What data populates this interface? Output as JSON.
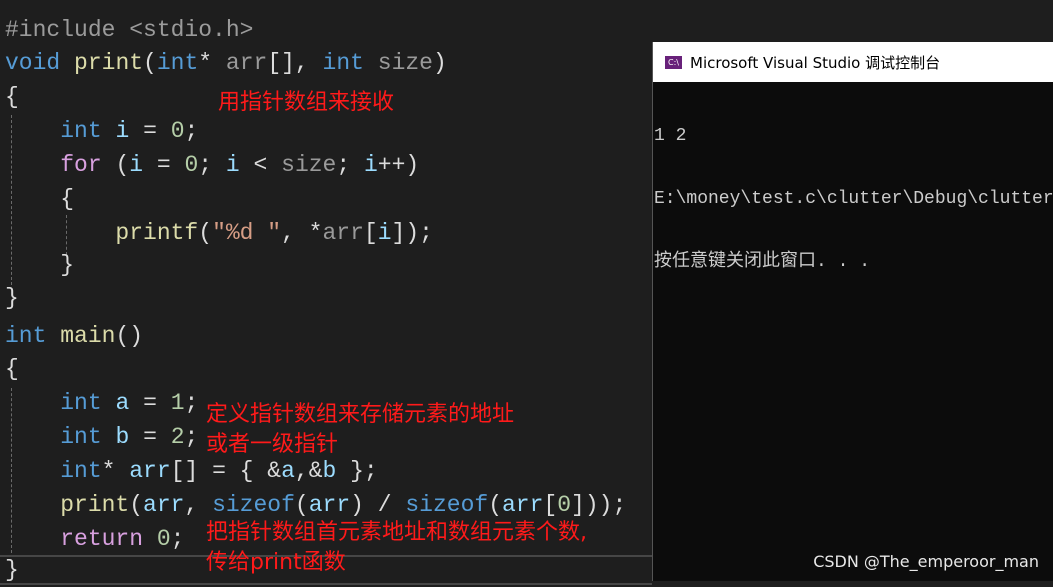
{
  "editor": {
    "lines": [
      [
        [
          "#include <stdio.h>",
          "pp"
        ]
      ],
      [
        [
          "void",
          "kw"
        ],
        [
          " ",
          "pl"
        ],
        [
          "print",
          "fn"
        ],
        [
          "(",
          "pl"
        ],
        [
          "int",
          "kw"
        ],
        [
          "* ",
          "pl"
        ],
        [
          "arr",
          "prm"
        ],
        [
          "[], ",
          "pl"
        ],
        [
          "int",
          "kw"
        ],
        [
          " ",
          "pl"
        ],
        [
          "size",
          "prm"
        ],
        [
          ")",
          "pl"
        ]
      ],
      [
        [
          "{",
          "pl"
        ]
      ],
      [
        [
          "    ",
          "pl"
        ],
        [
          "int",
          "kw"
        ],
        [
          " ",
          "pl"
        ],
        [
          "i",
          "var"
        ],
        [
          " = ",
          "pl"
        ],
        [
          "0",
          "num"
        ],
        [
          ";",
          "pl"
        ]
      ],
      [
        [
          "    ",
          "pl"
        ],
        [
          "for",
          "ctl"
        ],
        [
          " (",
          "pl"
        ],
        [
          "i",
          "var"
        ],
        [
          " = ",
          "pl"
        ],
        [
          "0",
          "num"
        ],
        [
          "; ",
          "pl"
        ],
        [
          "i",
          "var"
        ],
        [
          " < ",
          "pl"
        ],
        [
          "size",
          "prm"
        ],
        [
          "; ",
          "pl"
        ],
        [
          "i",
          "var"
        ],
        [
          "++)",
          "pl"
        ]
      ],
      [
        [
          "    {",
          "pl"
        ]
      ],
      [
        [
          "        ",
          "pl"
        ],
        [
          "printf",
          "fn"
        ],
        [
          "(",
          "pl"
        ],
        [
          "\"%d \"",
          "str"
        ],
        [
          ", *",
          "pl"
        ],
        [
          "arr",
          "prm"
        ],
        [
          "[",
          "pl"
        ],
        [
          "i",
          "var"
        ],
        [
          "]);",
          "pl"
        ]
      ],
      [
        [
          "    }",
          "pl"
        ]
      ],
      [
        [
          "}",
          "pl"
        ]
      ],
      [
        [
          "int",
          "kw"
        ],
        [
          " ",
          "pl"
        ],
        [
          "main",
          "fn"
        ],
        [
          "()",
          "pl"
        ]
      ],
      [
        [
          "{",
          "pl"
        ]
      ],
      [
        [
          "    ",
          "pl"
        ],
        [
          "int",
          "kw"
        ],
        [
          " ",
          "pl"
        ],
        [
          "a",
          "var"
        ],
        [
          " = ",
          "pl"
        ],
        [
          "1",
          "num"
        ],
        [
          ";",
          "pl"
        ]
      ],
      [
        [
          "    ",
          "pl"
        ],
        [
          "int",
          "kw"
        ],
        [
          " ",
          "pl"
        ],
        [
          "b",
          "var"
        ],
        [
          " = ",
          "pl"
        ],
        [
          "2",
          "num"
        ],
        [
          ";",
          "pl"
        ]
      ],
      [
        [
          "    ",
          "pl"
        ],
        [
          "int",
          "kw"
        ],
        [
          "* ",
          "pl"
        ],
        [
          "arr",
          "var"
        ],
        [
          "[] = { &",
          "pl"
        ],
        [
          "a",
          "var"
        ],
        [
          ",&",
          "pl"
        ],
        [
          "b",
          "var"
        ],
        [
          " };",
          "pl"
        ]
      ],
      [
        [
          "    ",
          "pl"
        ],
        [
          "print",
          "fn"
        ],
        [
          "(",
          "pl"
        ],
        [
          "arr",
          "var"
        ],
        [
          ", ",
          "pl"
        ],
        [
          "sizeof",
          "kw"
        ],
        [
          "(",
          "pl"
        ],
        [
          "arr",
          "var"
        ],
        [
          ") / ",
          "pl"
        ],
        [
          "sizeof",
          "kw"
        ],
        [
          "(",
          "pl"
        ],
        [
          "arr",
          "var"
        ],
        [
          "[",
          "pl"
        ],
        [
          "0",
          "num"
        ],
        [
          "]));",
          "pl"
        ]
      ],
      [
        [
          "    ",
          "pl"
        ],
        [
          "return",
          "ctl"
        ],
        [
          " ",
          "pl"
        ],
        [
          "0",
          "num"
        ],
        [
          ";",
          "pl"
        ]
      ],
      [
        [
          "}",
          "pl"
        ]
      ]
    ]
  },
  "annotations": {
    "receive": "用指针数组来接收",
    "define_line1": "定义指针数组来存储元素的地址",
    "define_line2": "或者一级指针",
    "pass_line1": "把指针数组首元素地址和数组元素个数,",
    "pass_line2": "传给print函数"
  },
  "console": {
    "icon_label": "C:\\",
    "title": "Microsoft Visual Studio 调试控制台",
    "output": [
      "1 2",
      "E:\\money\\test.c\\clutter\\Debug\\clutter.",
      "按任意键关闭此窗口. . ."
    ]
  },
  "watermark": "CSDN @The_emperoor_man",
  "colors": {
    "background": "#1e1e1e",
    "keyword": "#569cd6",
    "function": "#dcdcaa",
    "annotation": "#ff1a1a",
    "console_bg": "#0c0c0c"
  }
}
